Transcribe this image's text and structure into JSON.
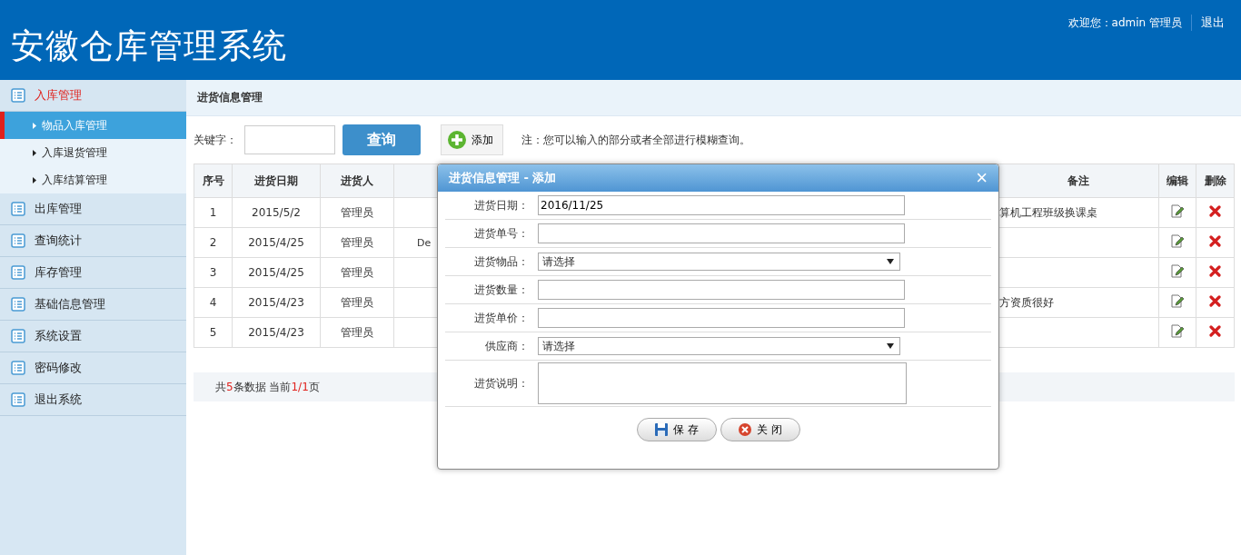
{
  "header": {
    "title": "安徽仓库管理系统",
    "welcome": "欢迎您：admin 管理员",
    "logout": "退出"
  },
  "sidebar": {
    "items": [
      {
        "label": "入库管理",
        "selected": true,
        "children": [
          {
            "label": "物品入库管理",
            "selected": true
          },
          {
            "label": "入库退货管理",
            "selected": false
          },
          {
            "label": "入库结算管理",
            "selected": false
          }
        ]
      },
      {
        "label": "出库管理",
        "selected": false
      },
      {
        "label": "查询统计",
        "selected": false
      },
      {
        "label": "库存管理",
        "selected": false
      },
      {
        "label": "基础信息管理",
        "selected": false
      },
      {
        "label": "系统设置",
        "selected": false
      },
      {
        "label": "密码修改",
        "selected": false
      },
      {
        "label": "退出系统",
        "selected": false
      }
    ]
  },
  "breadcrumb": "进货信息管理",
  "search": {
    "label": "关键字：",
    "query_button": "查询",
    "add_button": "添加",
    "note": "注：您可以输入的部分或者全部进行模糊查询。"
  },
  "table": {
    "columns": [
      "序号",
      "进货日期",
      "进货人",
      "备注",
      "编辑",
      "删除"
    ],
    "rows": [
      {
        "cells": [
          "1",
          "2015/5/2",
          "管理员"
        ],
        "remark": "算机工程班级换课桌"
      },
      {
        "cells": [
          "2",
          "2015/4/25",
          "管理员"
        ],
        "column_4": "De"
      },
      {
        "cells": [
          "3",
          "2015/4/25",
          "管理员"
        ]
      },
      {
        "cells": [
          "4",
          "2015/4/23",
          "管理员"
        ],
        "remark": "方资质很好"
      },
      {
        "cells": [
          "5",
          "2015/4/23",
          "管理员"
        ]
      }
    ]
  },
  "pager": {
    "prefix": "共",
    "count": "5",
    "middle": "条数据 当前",
    "page": "1/1",
    "suffix": "页"
  },
  "dialog": {
    "title": "进货信息管理 - 添加",
    "close": "×",
    "fields": [
      {
        "label": "进货日期：",
        "kind": "text",
        "value": "2016/11/25"
      },
      {
        "label": "进货单号：",
        "kind": "text"
      },
      {
        "label": "进货物品：",
        "kind": "select",
        "value": "请选择"
      },
      {
        "label": "进货数量：",
        "kind": "text"
      },
      {
        "label": "进货单价：",
        "kind": "text"
      },
      {
        "label": "供应商：",
        "kind": "select",
        "value": "请选择"
      },
      {
        "label": "进货说明：",
        "kind": "textarea"
      }
    ],
    "buttons": [
      {
        "label": "保 存",
        "kind": "save"
      },
      {
        "label": "关 闭",
        "kind": "close"
      }
    ]
  }
}
